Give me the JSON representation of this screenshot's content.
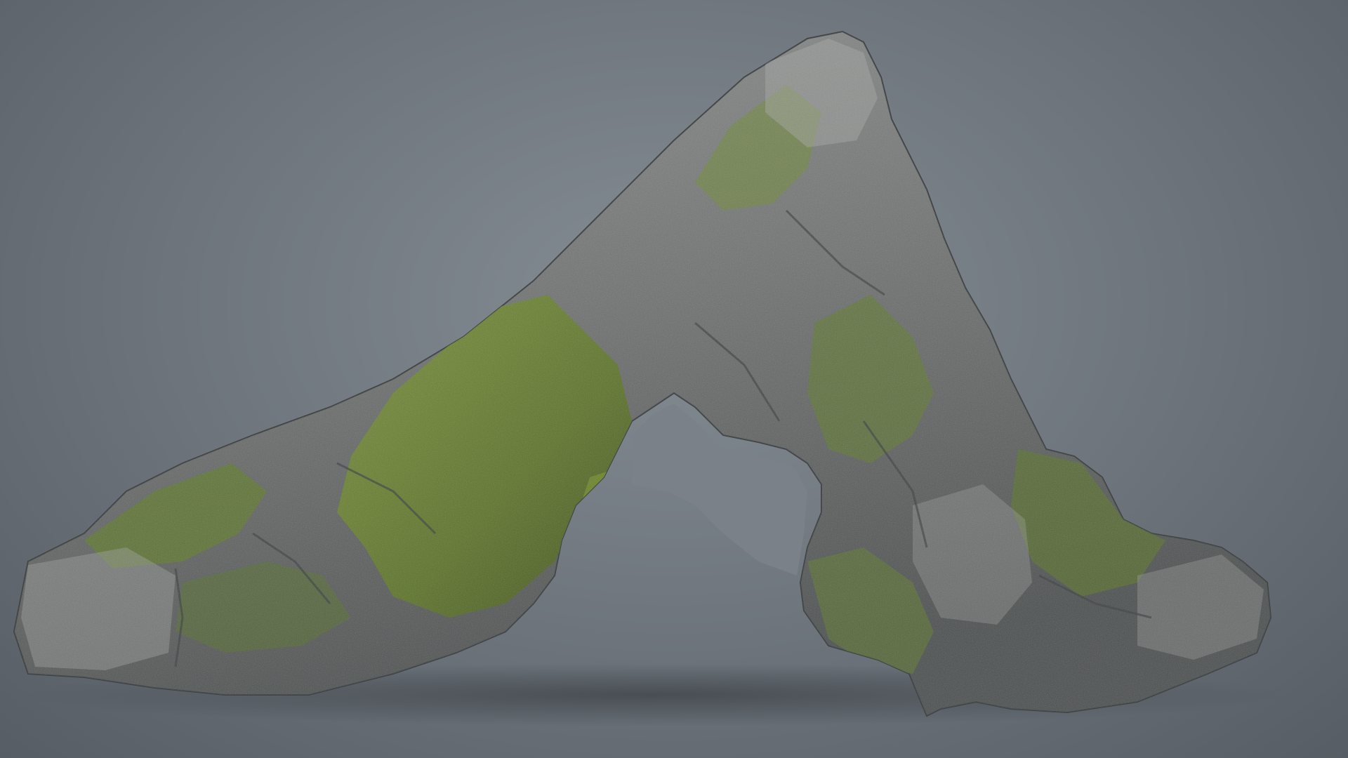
{
  "scene": {
    "subject": "mossy-rock-arch",
    "background_color": "#7a8189",
    "rock_color": "#6e7070",
    "rock_highlight_color": "#9a9c9a",
    "moss_color": "#5f7a2a",
    "moss_light_color": "#7f9632",
    "shadow_color": "#3a3d3f"
  }
}
